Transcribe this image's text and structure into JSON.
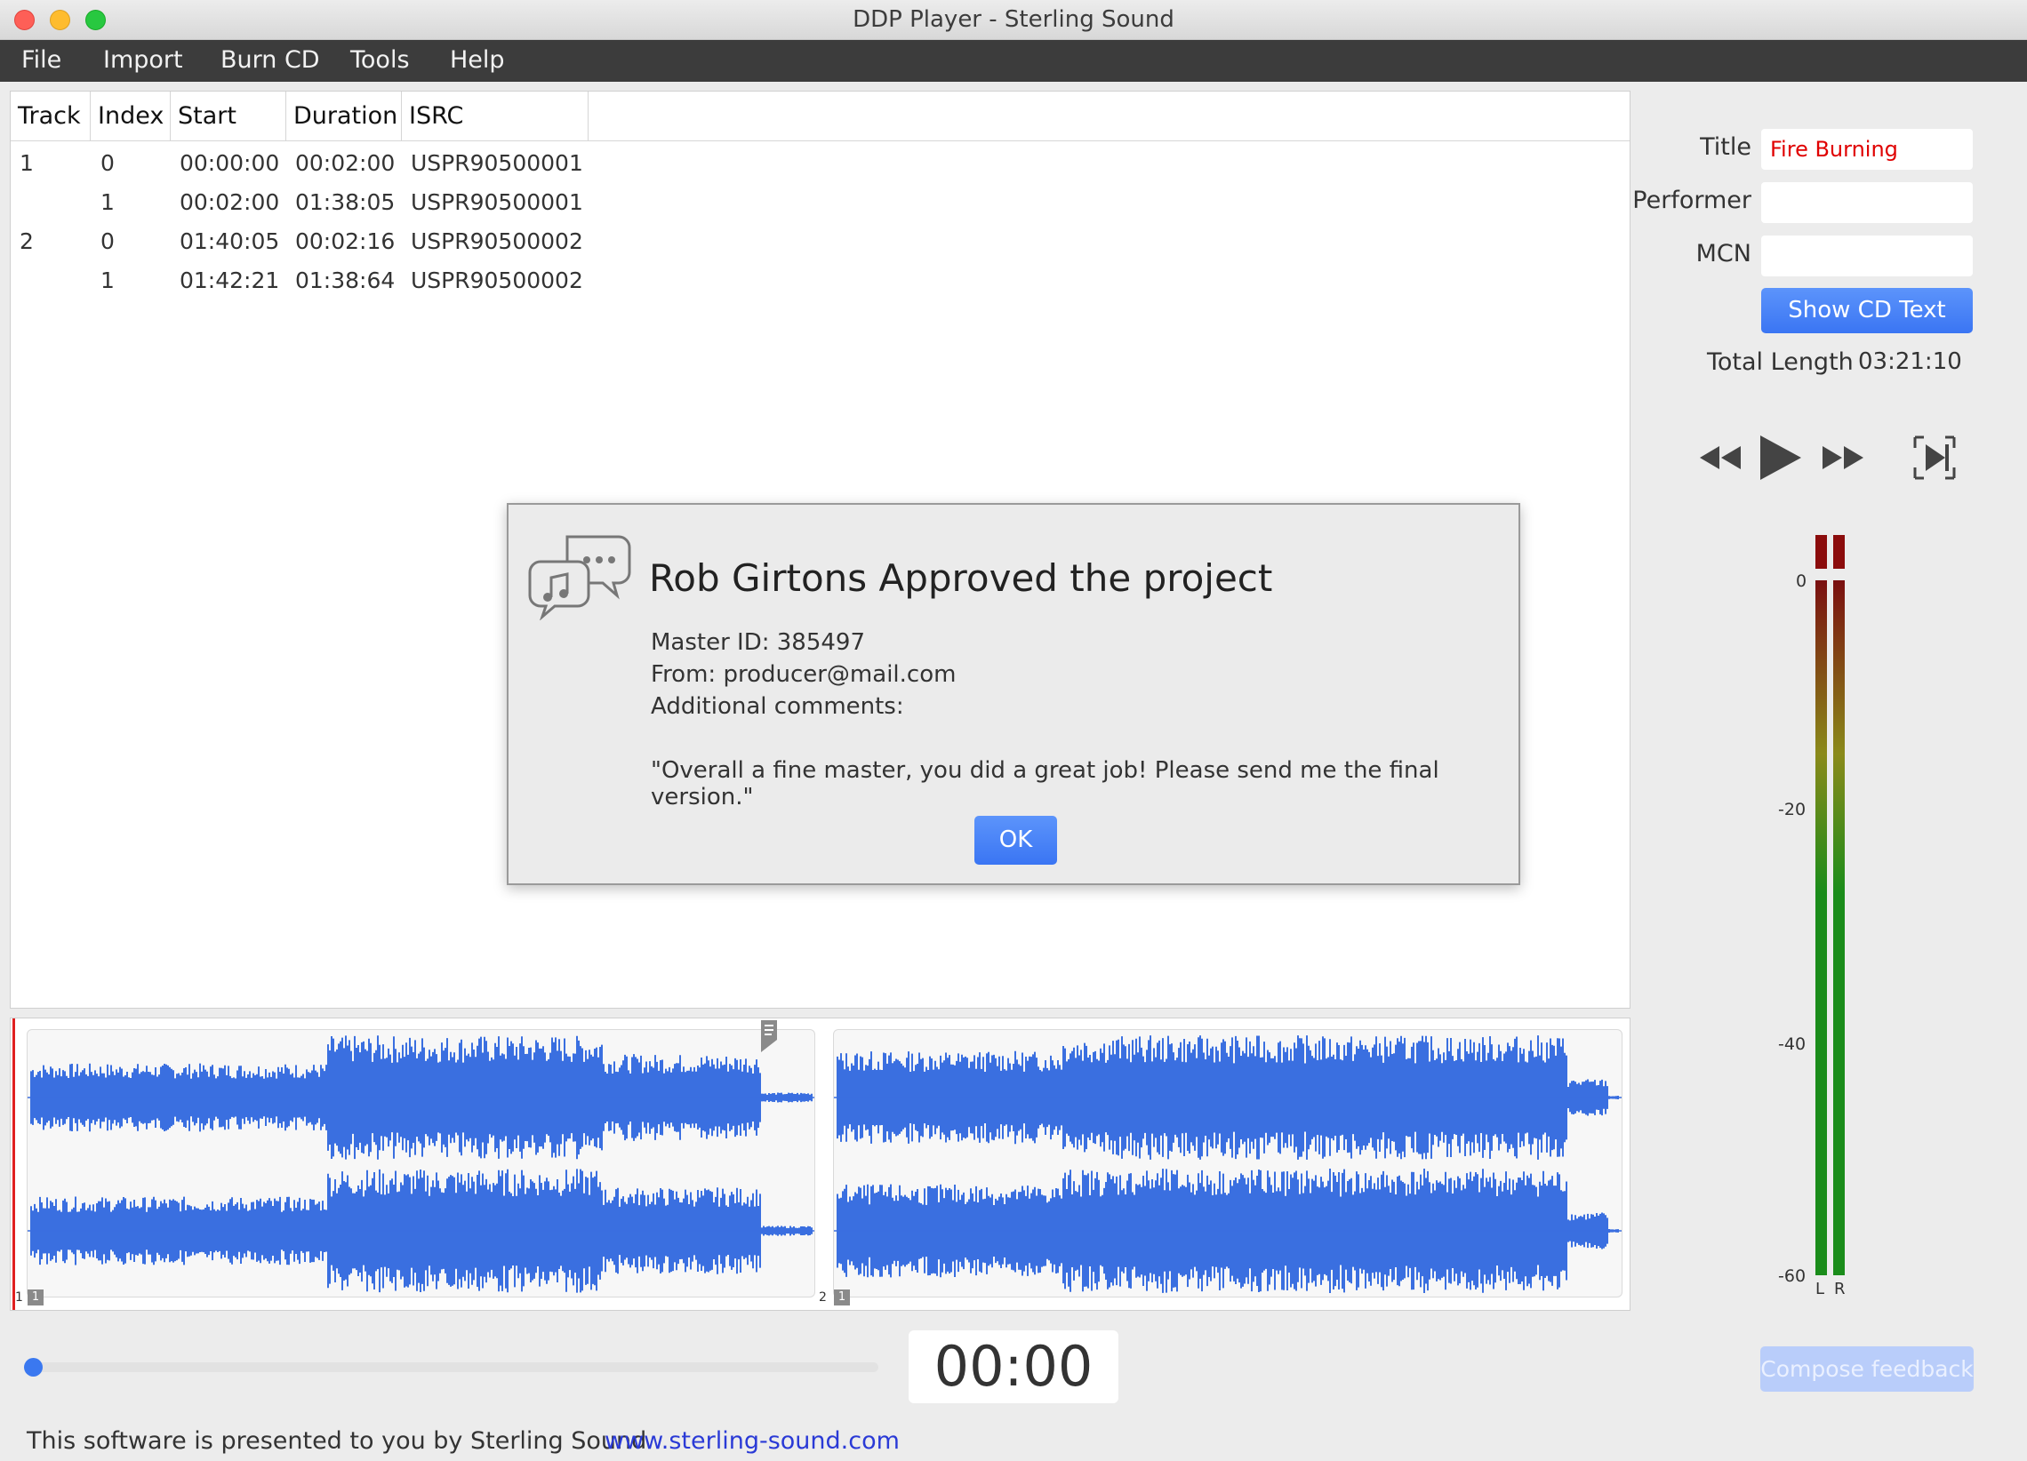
{
  "window": {
    "title": "DDP Player - Sterling Sound"
  },
  "menu": [
    "File",
    "Import",
    "Burn CD",
    "Tools",
    "Help"
  ],
  "table": {
    "headers": [
      "Track",
      "Index",
      "Start",
      "Duration",
      "ISRC"
    ],
    "rows": [
      {
        "track": "1",
        "index": "0",
        "start": "00:00:00",
        "duration": "00:02:00",
        "isrc": "USPR90500001"
      },
      {
        "track": "",
        "index": "1",
        "start": "00:02:00",
        "duration": "01:38:05",
        "isrc": "USPR90500001"
      },
      {
        "track": "2",
        "index": "0",
        "start": "01:40:05",
        "duration": "00:02:16",
        "isrc": "USPR90500002"
      },
      {
        "track": "",
        "index": "1",
        "start": "01:42:21",
        "duration": "01:38:64",
        "isrc": "USPR90500002"
      }
    ]
  },
  "info": {
    "title_label": "Title",
    "title_value": "Fire Burning",
    "performer_label": "Performer",
    "performer_value": "",
    "mcn_label": "MCN",
    "mcn_value": "",
    "show_cd_text": "Show CD Text",
    "total_length_label": "Total Length",
    "total_length_value": "03:21:10"
  },
  "transport": {
    "icons": [
      "rewind-icon",
      "play-icon",
      "fast-forward-icon",
      "skip-to-marker-icon"
    ]
  },
  "meter": {
    "scale": [
      "0",
      "-20",
      "-40",
      "-60"
    ],
    "left_label": "L",
    "right_label": "R",
    "colors": {
      "peak": "#8b0c0c",
      "top": "#7a0f10",
      "mid": "#8a8a1a",
      "bottom": "#1a8c1a"
    }
  },
  "waveform": {
    "color": "#3a6fe0",
    "tracks": [
      {
        "number": "1",
        "index": "1"
      },
      {
        "number": "2",
        "index": "1"
      }
    ]
  },
  "playback": {
    "time": "00:00",
    "position": 0
  },
  "compose_feedback": "Compose feedback",
  "footer": {
    "text": "This software is presented to you by Sterling Sound",
    "link": "www.sterling-sound.com"
  },
  "dialog": {
    "title": "Rob Girtons Approved the project",
    "master_id": "Master ID: 385497",
    "from": "From: producer@mail.com",
    "comments_label": "Additional comments:",
    "comment": "\"Overall a fine master, you did a great job! Please send me the final version.\"",
    "ok": "OK"
  },
  "colors": {
    "accent": "#3a78f0",
    "title_text": "#e00000",
    "link": "#2a3ad6"
  }
}
